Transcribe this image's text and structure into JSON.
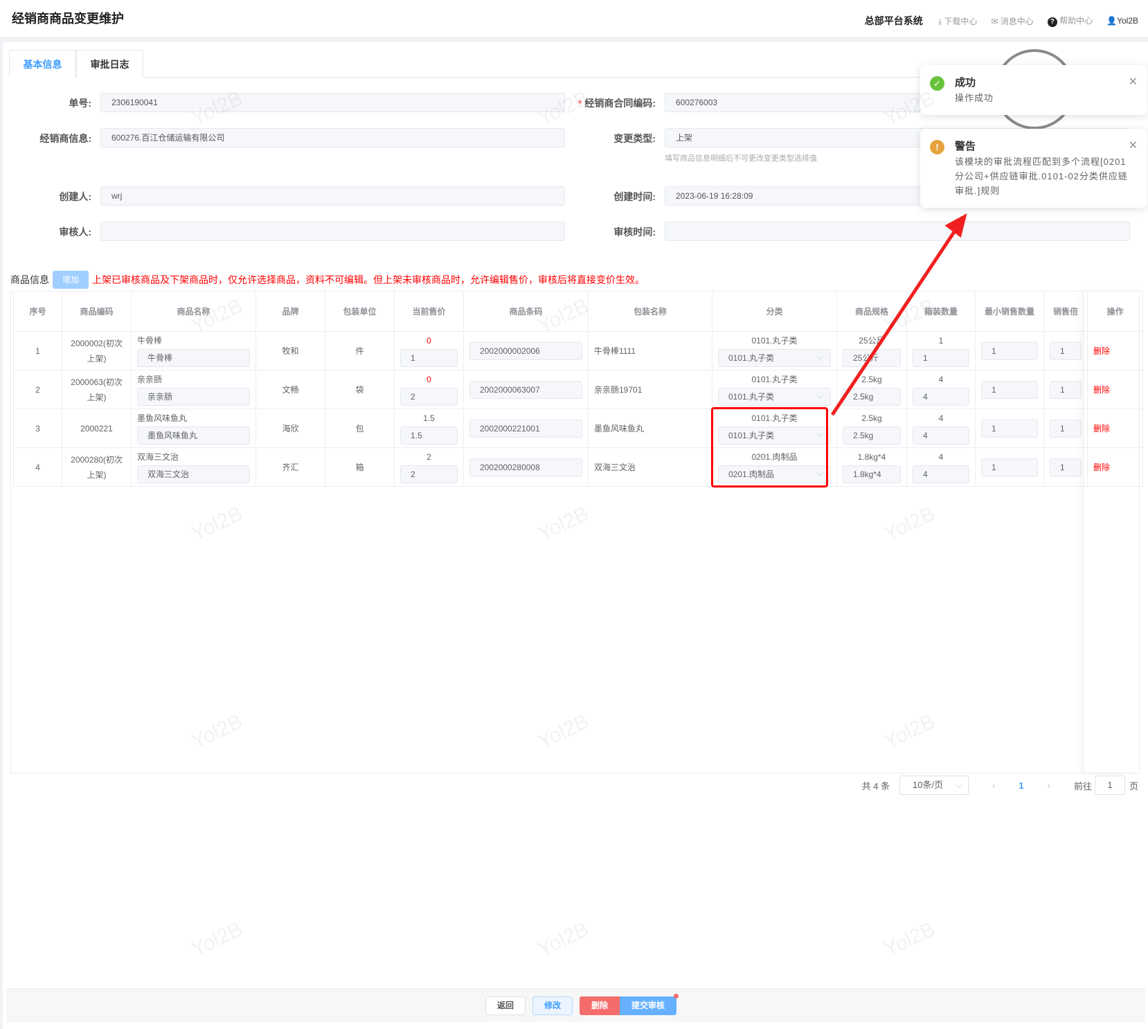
{
  "header": {
    "title": "经销商商品变更维护",
    "system": "总部平台系统",
    "download": "下载中心",
    "messages": "消息中心",
    "help": "帮助中心",
    "user": "Yol2B"
  },
  "tabs": [
    "基本信息",
    "审批日志"
  ],
  "form": {
    "order_no": {
      "label": "单号:",
      "value": "2306190041"
    },
    "contract_code": {
      "label": "经销商合同编码:",
      "value": "600276003"
    },
    "dealer_info": {
      "label": "经销商信息:",
      "value": "600276.百江仓储运输有限公司"
    },
    "change_type": {
      "label": "变更类型:",
      "value": "上架",
      "hint": "填写商品信息明细后不可更改变更类型选择值"
    },
    "creator": {
      "label": "创建人:",
      "value": "wrj"
    },
    "create_time": {
      "label": "创建时间:",
      "value": "2023-06-19 16:28:09"
    },
    "reviewer": {
      "label": "审核人:",
      "value": ""
    },
    "review_time": {
      "label": "审核时间:",
      "value": ""
    }
  },
  "goods": {
    "title": "商品信息",
    "add": "增加",
    "notice": "上架已审核商品及下架商品时，仅允许选择商品，资料不可编辑。但上架未审核商品时，允许编辑售价，审核后将直接变价生效。"
  },
  "table": {
    "headers": [
      "序号",
      "商品编码",
      "商品名称",
      "品牌",
      "包装单位",
      "当前售价",
      "商品条码",
      "包装名称",
      "分类",
      "商品规格",
      "箱装数量",
      "最小销售数量",
      "销售倍",
      "操作"
    ],
    "rows": [
      {
        "no": "1",
        "code": "2000002(初次上架)",
        "name": "牛骨棒",
        "name_in": "牛骨棒",
        "brand": "牧和",
        "unit": "件",
        "price": "0",
        "price_in": "1",
        "barcode": "2002000002006",
        "pack": "牛骨棒1111",
        "cat": "0101.丸子类",
        "cat_in": "0101.丸子类",
        "spec": "25公斤",
        "spec_in": "25公斤",
        "box": "1",
        "box_in": "1",
        "min": "1",
        "mult": "1",
        "op": "删除"
      },
      {
        "no": "2",
        "code": "2000063(初次上架)",
        "name": "亲亲肠",
        "name_in": "亲亲肠",
        "brand": "文畅",
        "unit": "袋",
        "price": "0",
        "price_in": "2",
        "barcode": "2002000063007",
        "pack": "亲亲肠19701",
        "cat": "0101.丸子类",
        "cat_in": "0101.丸子类",
        "spec": "2.5kg",
        "spec_in": "2.5kg",
        "box": "4",
        "box_in": "4",
        "min": "1",
        "mult": "1",
        "op": "删除"
      },
      {
        "no": "3",
        "code": "2000221",
        "name": "墨鱼风味鱼丸",
        "name_in": "墨鱼风味鱼丸",
        "brand": "海欣",
        "unit": "包",
        "price": "1.5",
        "price_in": "1.5",
        "barcode": "2002000221001",
        "pack": "墨鱼风味鱼丸",
        "cat": "0101.丸子类",
        "cat_in": "0101.丸子类",
        "spec": "2.5kg",
        "spec_in": "2.5kg",
        "box": "4",
        "box_in": "4",
        "min": "1",
        "mult": "1",
        "op": "删除"
      },
      {
        "no": "4",
        "code": "2000280(初次上架)",
        "name": "双海三文治",
        "name_in": "双海三文治",
        "brand": "齐汇",
        "unit": "箱",
        "price": "2",
        "price_in": "2",
        "barcode": "2002000280008",
        "pack": "双海三文治",
        "cat": "0201.肉制品",
        "cat_in": "0201.肉制品",
        "spec": "1.8kg*4",
        "spec_in": "1.8kg*4",
        "box": "4",
        "box_in": "4",
        "min": "1",
        "mult": "1",
        "op": "删除"
      }
    ]
  },
  "pagination": {
    "total": "共 4 条",
    "page_size": "10条/页",
    "current": "1",
    "goto": "前往",
    "goto_value": "1",
    "page_suffix": "页"
  },
  "footer": {
    "back": "返回",
    "edit": "修改",
    "delete": "删除",
    "submit": "提交审核"
  },
  "notifications": [
    {
      "type": "success",
      "title": "成功",
      "message": "操作成功"
    },
    {
      "type": "warning",
      "title": "警告",
      "message": "该模块的审批流程匹配到多个流程[0201分公司+供应链审批.0101-02分类供应链审批.]规则"
    }
  ],
  "watermark": "Yol2B",
  "colors": {
    "primary": "#409eff",
    "danger": "#f56c6c",
    "success": "#67c23a",
    "warning": "#e6a23c"
  }
}
